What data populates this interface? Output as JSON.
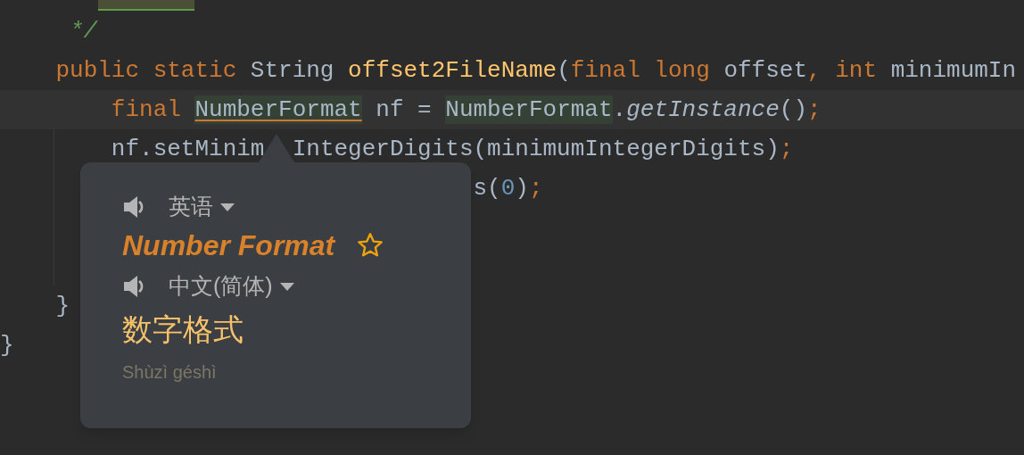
{
  "editor": {
    "lines": [
      {
        "tokens": [
          {
            "text": "     */",
            "kind": "comment"
          }
        ]
      },
      {
        "tokens": [
          {
            "text": "    public static ",
            "kind": "keyword"
          },
          {
            "text": "String ",
            "kind": "plain"
          },
          {
            "text": "offset2FileName",
            "kind": "function"
          },
          {
            "text": "(",
            "kind": "plain"
          },
          {
            "text": "final long ",
            "kind": "keyword"
          },
          {
            "text": "offset",
            "kind": "plain"
          },
          {
            "text": ", ",
            "kind": "punct"
          },
          {
            "text": "int ",
            "kind": "keyword"
          },
          {
            "text": "minimumIn",
            "kind": "plain"
          }
        ]
      },
      {
        "current": true,
        "tokens": [
          {
            "text": "        final ",
            "kind": "keyword"
          },
          {
            "text": "NumberFormat",
            "kind": "reference"
          },
          {
            "text": " nf = ",
            "kind": "plain"
          },
          {
            "text": "NumberFormat",
            "kind": "usage"
          },
          {
            "text": ".",
            "kind": "plain"
          },
          {
            "text": "getInstance",
            "kind": "method"
          },
          {
            "text": "()",
            "kind": "plain"
          },
          {
            "text": ";",
            "kind": "punct"
          }
        ]
      },
      {
        "tokens": [
          {
            "text": "        nf.setMinim",
            "kind": "plain"
          },
          {
            "text": "IntegerDigits(minimumIntegerDigits)",
            "kind": "resume"
          },
          {
            "text": ";",
            "kind": "punct"
          }
        ]
      },
      {
        "partial": true,
        "tokens": [
          {
            "text": "s(",
            "kind": "plain"
          },
          {
            "text": "0",
            "kind": "number"
          },
          {
            "text": ")",
            "kind": "plain"
          },
          {
            "text": ";",
            "kind": "punct"
          }
        ]
      },
      {
        "kind": "blank"
      },
      {
        "kind": "blank"
      },
      {
        "tokens": [
          {
            "text": "    }",
            "kind": "plain"
          }
        ]
      },
      {
        "tokens": [
          {
            "text": "}",
            "kind": "plain"
          }
        ]
      }
    ]
  },
  "popup": {
    "source_language": "英语",
    "source_term": "Number Format",
    "starred": false,
    "target_language": "中文(简体)",
    "translation": "数字格式",
    "pinyin": "Shùzì géshì"
  }
}
